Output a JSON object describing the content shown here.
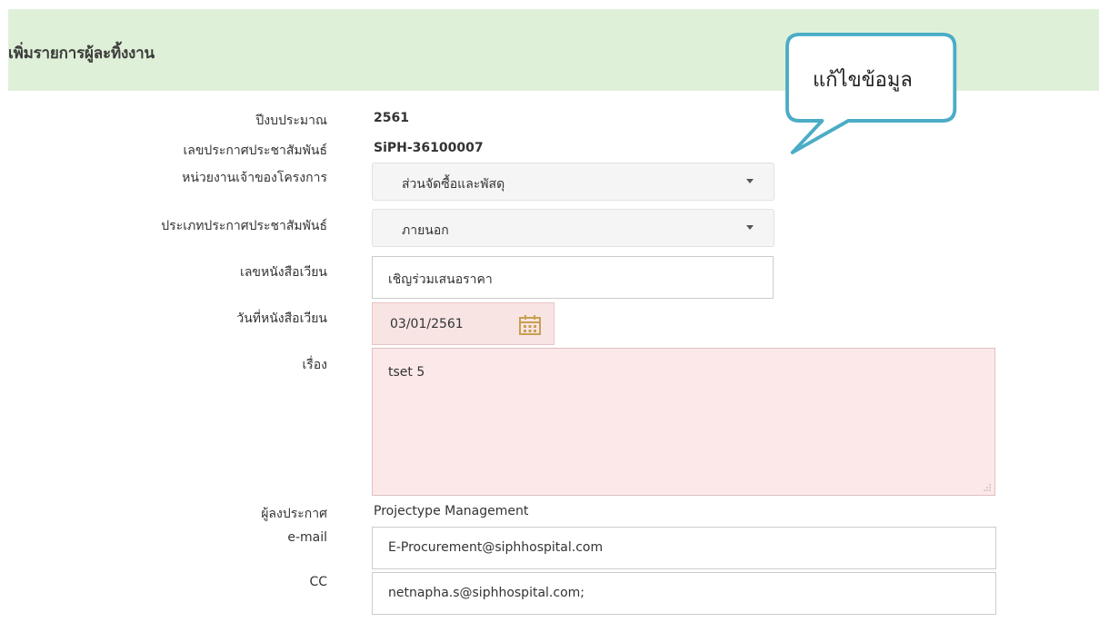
{
  "page": {
    "title": "เพิ่มรายการผู้ละทิ้งงาน"
  },
  "callout": {
    "text": "แก้ไขข้อมูล",
    "border_color": "#4bacc6"
  },
  "form": {
    "budget_year": {
      "label": "ปีงบประมาณ",
      "value": "2561"
    },
    "announcement_no": {
      "label": "เลขประกาศประชาสัมพันธ์",
      "value": "SiPH-36100007"
    },
    "project_owner": {
      "label": "หน่วยงานเจ้าของโครงการ",
      "value": "ส่วนจัดซื้อและพัสดุ"
    },
    "announcement_type": {
      "label": "ประเภทประกาศประชาสัมพันธ์",
      "value": "ภายนอก"
    },
    "circular_no": {
      "label": "เลขหนังสือเวียน",
      "value": "เชิญร่วมเสนอราคา"
    },
    "circular_date": {
      "label": "วันที่หนังสือเวียน",
      "value": "03/01/2561"
    },
    "subject": {
      "label": "เรื่อง",
      "value": "tset 5"
    },
    "announcer": {
      "label": "ผู้ลงประกาศ",
      "value": "Projectype Management"
    },
    "email": {
      "label": "e-mail",
      "value": "E-Procurement@siphhospital.com"
    },
    "cc": {
      "label": "CC",
      "value": "netnapha.s@siphhospital.com;"
    }
  },
  "colors": {
    "header_bg": "#dff0d8",
    "error_field_bg": "#fce8e8",
    "calendar_icon": "#c8a050"
  }
}
